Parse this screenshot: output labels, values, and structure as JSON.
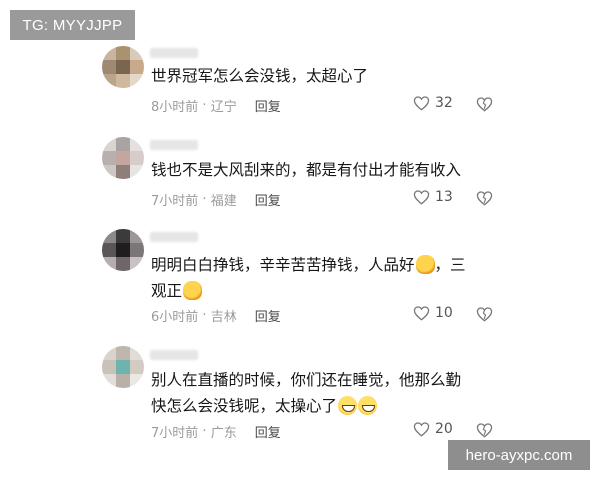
{
  "watermark_top": "TG: MYYJJPP",
  "watermark_bottom": "hero-ayxpc.com",
  "reply_label": "回复",
  "comments": [
    {
      "line1": "世界冠军怎么会没钱，太超心了",
      "line2": "",
      "time": "8小时前",
      "location": "辽宁",
      "likes": "32"
    },
    {
      "line1": "钱也不是大风刮来的，都是有付出才能有收入",
      "line2": "",
      "time": "7小时前",
      "location": "福建",
      "likes": "13"
    },
    {
      "line1": "明明白白挣钱，辛辛苦苦挣钱，人品好",
      "line1_end": "，三",
      "line2": "观正",
      "time": "6小时前",
      "location": "吉林",
      "likes": "10"
    },
    {
      "line1": "别人在直播的时候，你们还在睡觉，他那么勤",
      "line2": "快怎么会没钱呢，太操心了",
      "time": "7小时前",
      "location": "广东",
      "likes": "20"
    }
  ],
  "icons": {
    "like": "heart-outline-icon",
    "dislike": "broken-heart-icon",
    "emoji_thumb": "thumbs-up-emoji",
    "emoji_grin": "grinning-face-emoji"
  }
}
